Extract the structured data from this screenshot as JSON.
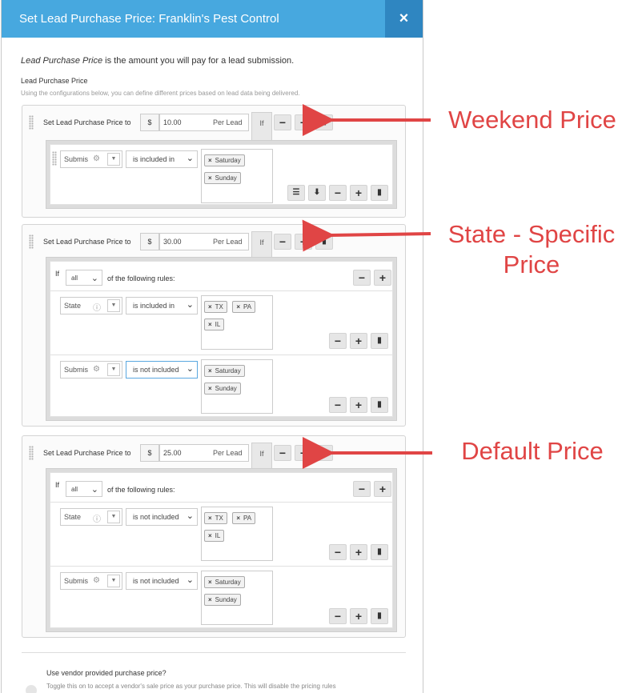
{
  "modal": {
    "title": "Set Lead Purchase Price: Franklin's Pest Control",
    "close_label": "×",
    "intro_italic": "Lead Purchase Price",
    "intro_rest": " is the amount you will pay for a lead submission.",
    "section_label": "Lead Purchase Price",
    "section_help": "Using the configurations below, you can define different prices based on lead data being delivered."
  },
  "common": {
    "set_label": "Set Lead Purchase Price to",
    "currency": "$",
    "per_lead": "Per Lead",
    "if_label": "If",
    "if_word": "If",
    "following_rules": "of the following rules:"
  },
  "blocks": [
    {
      "price": "10.00",
      "match": "",
      "rules": [
        {
          "field": "Submis",
          "operator": "is included in",
          "values": [
            "Saturday",
            "Sunday"
          ]
        }
      ]
    },
    {
      "price": "30.00",
      "match": "all",
      "rules": [
        {
          "field": "State",
          "operator": "is included in",
          "values": [
            "TX",
            "PA",
            "IL"
          ]
        },
        {
          "field": "Submis",
          "operator": "is not included",
          "values": [
            "Saturday",
            "Sunday"
          ]
        }
      ]
    },
    {
      "price": "25.00",
      "match": "all",
      "rules": [
        {
          "field": "State",
          "operator": "is not included",
          "values": [
            "TX",
            "PA",
            "IL"
          ]
        },
        {
          "field": "Submis",
          "operator": "is not included",
          "values": [
            "Saturday",
            "Sunday"
          ]
        }
      ]
    }
  ],
  "vendor": {
    "question": "Use vendor provided purchase price?",
    "help": "Toggle this on to accept a vendor's sale price as your purchase price. This will disable the pricing rules"
  },
  "callouts": {
    "weekend": "Weekend Price",
    "state_line1": "State - Specific",
    "state_line2": "Price",
    "default": "Default Price"
  },
  "colors": {
    "header": "#47a8df",
    "close_bg": "#2f86c1",
    "callout": "#e04545"
  },
  "icons": {
    "copy": "copy-icon",
    "plus": "plus-icon",
    "minus": "minus-icon",
    "gear": "gear-icon",
    "info": "info-icon",
    "list": "list-icon",
    "download": "download-icon"
  }
}
